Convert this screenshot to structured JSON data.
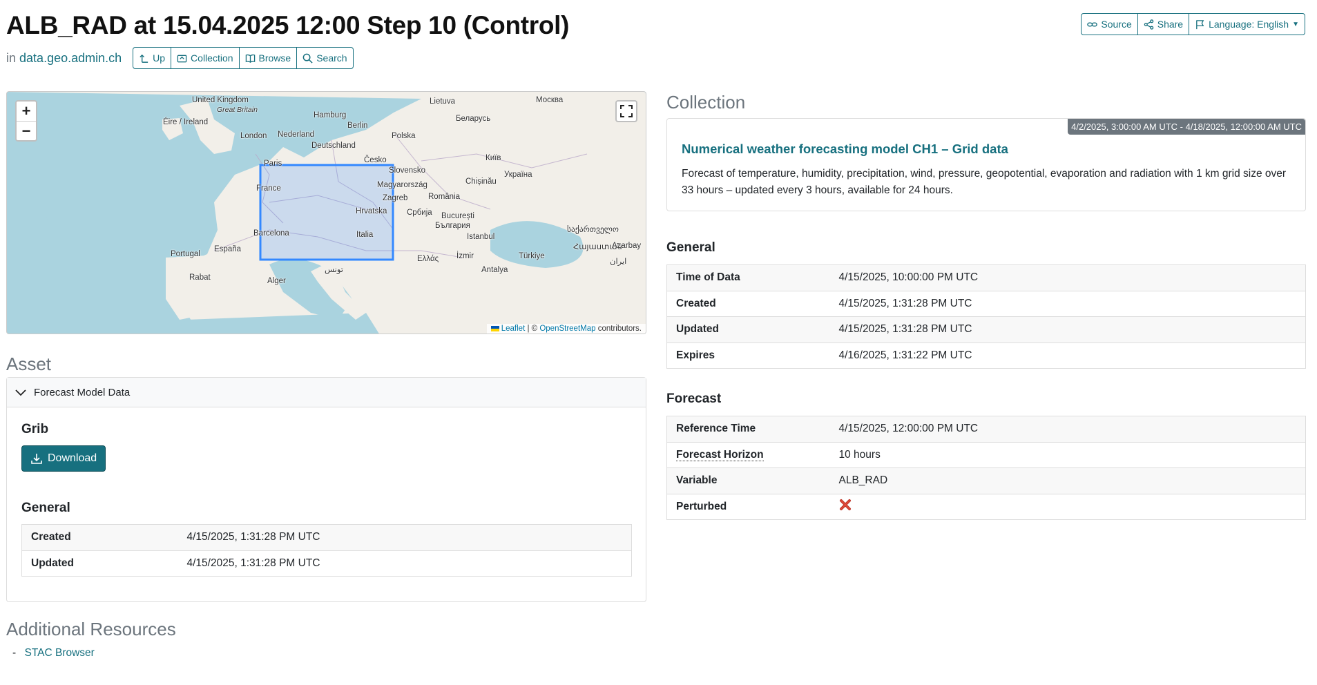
{
  "page": {
    "title": "ALB_RAD at 15.04.2025 12:00 Step 10 (Control)",
    "in_prefix": "in",
    "in_link": "data.geo.admin.ch"
  },
  "nav": {
    "up": "Up",
    "collection": "Collection",
    "browse": "Browse",
    "search": "Search"
  },
  "top_actions": {
    "source": "Source",
    "share": "Share",
    "language": "Language: English"
  },
  "map": {
    "zoom_in": "+",
    "zoom_out": "−",
    "attribution_leaflet": "Leaflet",
    "attribution_sep": "| ©",
    "attribution_osm": "OpenStreetMap",
    "attribution_suffix": "contributors.",
    "labels": [
      "United Kingdom",
      "Great Britain",
      "Éire / Ireland",
      "London",
      "Hamburg",
      "Berlin",
      "Nederland",
      "Deutschland",
      "Polska",
      "Lietuva",
      "Москва",
      "Беларусь",
      "Paris",
      "Česko",
      "Slovensko",
      "Київ",
      "Україна",
      "France",
      "Magyarország",
      "Chișinău",
      "Zagreb",
      "România",
      "Hrvatska",
      "Србија",
      "București",
      "Barcelona",
      "Italia",
      "България",
      "Istanbul",
      "საქართველო",
      "Portugal",
      "España",
      "Ελλάς",
      "İzmir",
      "Türkiye",
      "Հայաստան",
      "Azarbay",
      "Rabat",
      "Alger",
      "تونس",
      "Antalya",
      "ایران"
    ]
  },
  "asset": {
    "heading": "Asset",
    "card_title": "Forecast Model Data",
    "grib_heading": "Grib",
    "download_label": "Download",
    "general_heading": "General",
    "rows": [
      {
        "key": "Created",
        "value": "4/15/2025, 1:31:28 PM UTC"
      },
      {
        "key": "Updated",
        "value": "4/15/2025, 1:31:28 PM UTC"
      }
    ]
  },
  "resources": {
    "heading": "Additional Resources",
    "items": [
      "STAC Browser"
    ],
    "bullet": "-"
  },
  "collection": {
    "heading": "Collection",
    "badge": "4/2/2025, 3:00:00 AM UTC - 4/18/2025, 12:00:00 AM UTC",
    "title": "Numerical weather forecasting model CH1 – Grid data",
    "description": "Forecast of temperature, humidity, precipitation, wind, pressure, geopotential, evaporation and radiation with 1 km grid size over 33 hours – updated every 3 hours, available for 24 hours."
  },
  "general": {
    "heading": "General",
    "rows": [
      {
        "key": "Time of Data",
        "value": "4/15/2025, 10:00:00 PM UTC"
      },
      {
        "key": "Created",
        "value": "4/15/2025, 1:31:28 PM UTC"
      },
      {
        "key": "Updated",
        "value": "4/15/2025, 1:31:28 PM UTC"
      },
      {
        "key": "Expires",
        "value": "4/16/2025, 1:31:22 PM UTC"
      }
    ]
  },
  "forecast": {
    "heading": "Forecast",
    "rows": [
      {
        "key": "Reference Time",
        "value": "4/15/2025, 12:00:00 PM UTC"
      },
      {
        "key": "Forecast Horizon",
        "value": "10 hours"
      },
      {
        "key": "Variable",
        "value": "ALB_RAD"
      },
      {
        "key": "Perturbed",
        "value": ""
      }
    ]
  },
  "colors": {
    "accent": "#17707f",
    "perturbed_false": "#c0392b",
    "bbox": "#3388ff"
  }
}
